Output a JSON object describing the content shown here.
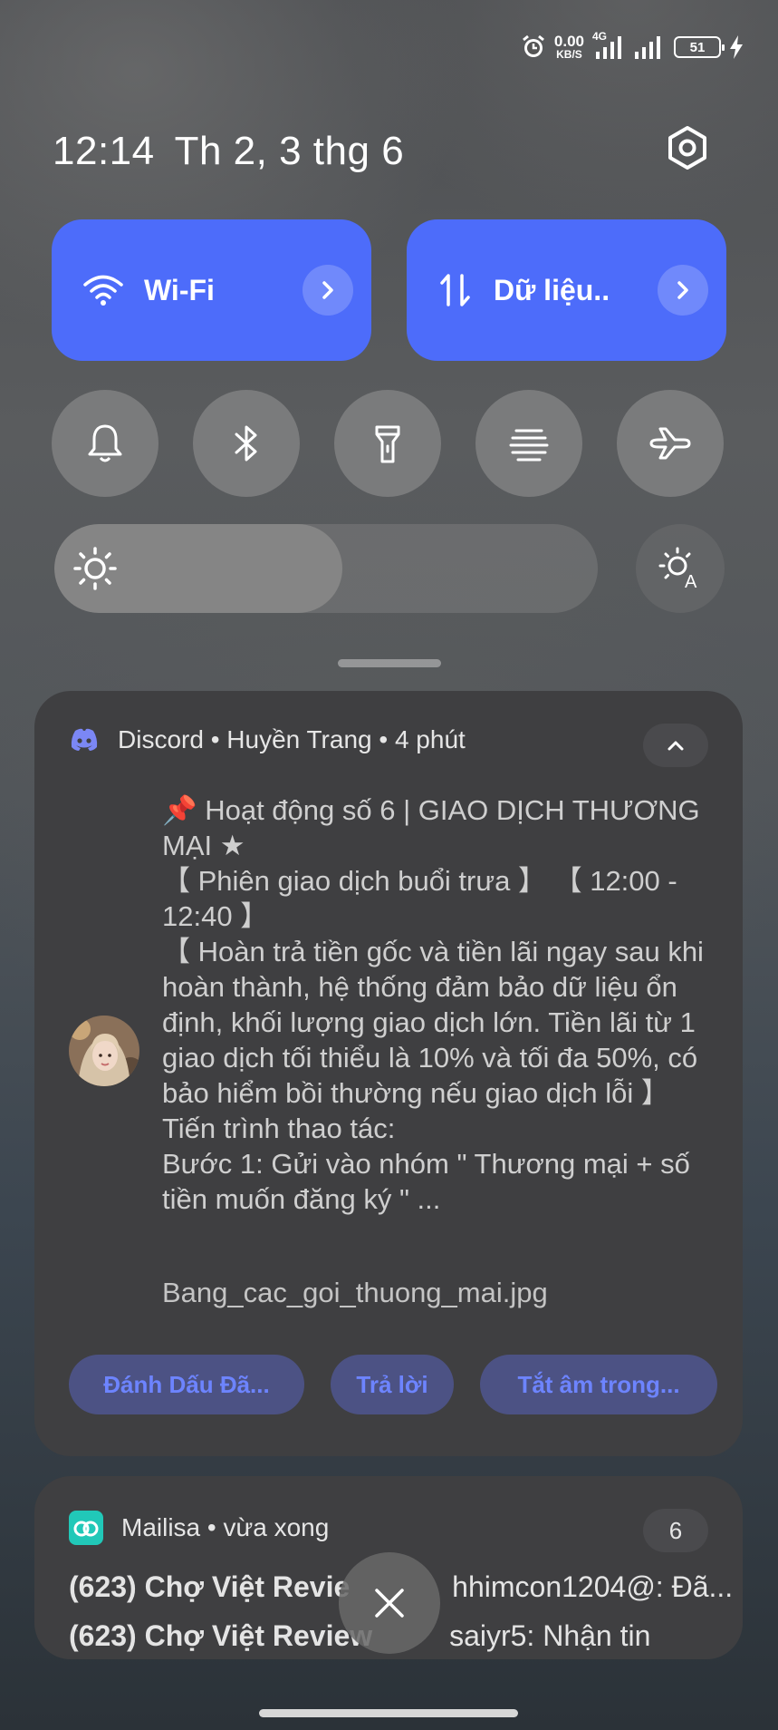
{
  "status_bar": {
    "net_speed_value": "0.00",
    "net_speed_unit": "KB/S",
    "network_type": "4G",
    "battery_level": "51",
    "icons": [
      "alarm-icon",
      "signal-icon",
      "signal-icon",
      "battery-icon",
      "charging-icon"
    ]
  },
  "header": {
    "time": "12:14",
    "date": "Th 2, 3 thg 6"
  },
  "quick_tiles": [
    {
      "label": "Wi-Fi",
      "icon": "wifi-icon"
    },
    {
      "label": "Dữ liệu..",
      "icon": "mobile-data-icon"
    }
  ],
  "toggles": [
    "bell-icon",
    "bluetooth-icon",
    "flashlight-icon",
    "nfc-icon",
    "airplane-icon"
  ],
  "brightness": {
    "level": 0.53
  },
  "notification_discord": {
    "app": "Discord",
    "sender": "Huyền Trang",
    "time": "4 phút",
    "header_text": "Discord • Huyền Trang • 4 phút",
    "message_lines": [
      "📌 Hoạt động số 6 | GIAO DỊCH THƯƠNG MẠI ★",
      "【 Phiên giao dịch buổi trưa 】 【 12:00 - 12:40 】",
      "【 Hoàn trả tiền gốc và tiền lãi ngay sau khi hoàn thành, hệ thống đảm bảo dữ liệu ổn định, khối lượng giao dịch lớn. Tiền lãi từ 1 giao dịch tối thiểu là 10% và tối đa 50%, có bảo hiểm bồi thường nếu giao dịch lỗi 】",
      "Tiến trình thao tác:",
      "Bước 1: Gửi vào nhóm \" Thương mại + số tiền muốn đăng ký \" ..."
    ],
    "attachment": "Bang_cac_goi_thuong_mai.jpg",
    "actions": [
      "Đánh Dấu Đã...",
      "Trả lời",
      "Tắt âm trong..."
    ]
  },
  "notification_mailisa": {
    "header_text": "Mailisa • vừa xong",
    "count": "6",
    "lines": [
      {
        "title": "(623) Chợ Việt Revie",
        "rest": "hhimcon1204@: Đã..."
      },
      {
        "title": "(623) Chợ Việt Review",
        "rest": "saiyr5: Nhận tin"
      }
    ]
  }
}
